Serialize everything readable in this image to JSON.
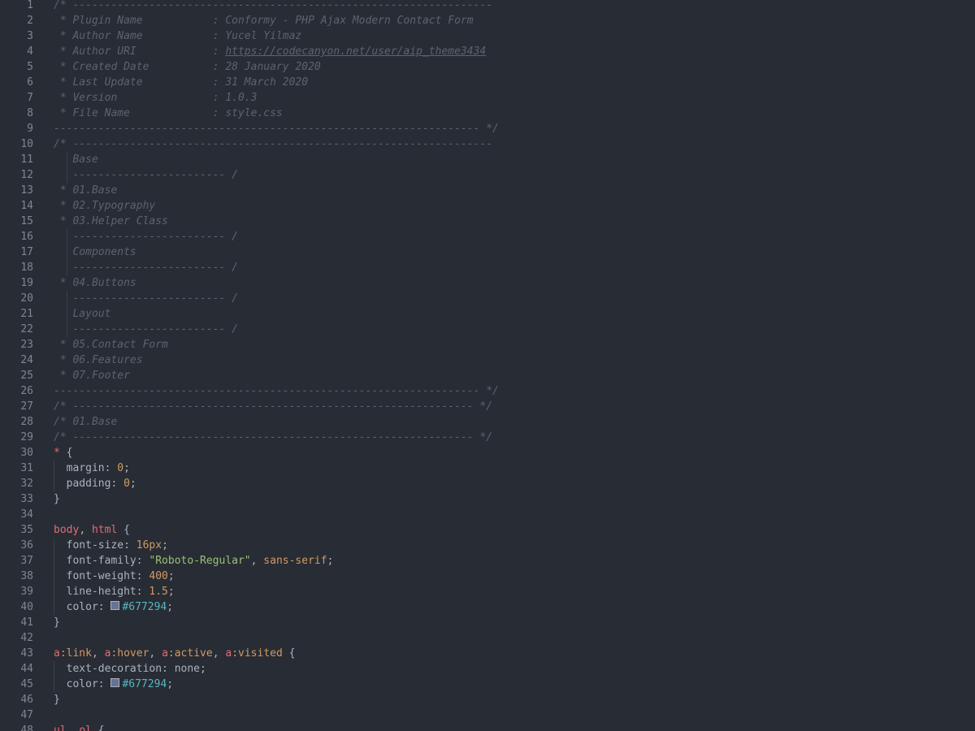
{
  "editor": {
    "language": "css",
    "theme_colors": {
      "background": "#282c34",
      "gutter_text": "#7f8594",
      "comment": "#5c6370",
      "selector": "#e06c75",
      "number": "#d19a66",
      "string": "#98c379",
      "color_value": "#56b6c2",
      "swatch_color": "#677294"
    },
    "lines": [
      {
        "n": "1",
        "tokens": [
          {
            "t": "comment",
            "v": "/* ------------------------------------------------------------------"
          }
        ]
      },
      {
        "n": "2",
        "tokens": [
          {
            "t": "comment",
            "v": " * Plugin Name           : Conformy - PHP Ajax Modern Contact Form"
          }
        ]
      },
      {
        "n": "3",
        "tokens": [
          {
            "t": "comment",
            "v": " * Author Name           : Yucel Yilmaz"
          }
        ]
      },
      {
        "n": "4",
        "tokens": [
          {
            "t": "comment",
            "v": " * Author URI            : "
          },
          {
            "t": "url",
            "v": "https://codecanyon.net/user/aip_theme3434"
          }
        ]
      },
      {
        "n": "5",
        "tokens": [
          {
            "t": "comment",
            "v": " * Created Date          : 28 January 2020"
          }
        ]
      },
      {
        "n": "6",
        "tokens": [
          {
            "t": "comment",
            "v": " * Last Update           : 31 March 2020"
          }
        ]
      },
      {
        "n": "7",
        "tokens": [
          {
            "t": "comment",
            "v": " * Version               : 1.0.3"
          }
        ]
      },
      {
        "n": "8",
        "tokens": [
          {
            "t": "comment",
            "v": " * File Name             : style.css"
          }
        ]
      },
      {
        "n": "9",
        "tokens": [
          {
            "t": "comment",
            "v": "------------------------------------------------------------------- */"
          }
        ]
      },
      {
        "n": "10",
        "tokens": [
          {
            "t": "comment",
            "v": "/* ------------------------------------------------------------------"
          }
        ]
      },
      {
        "n": "11",
        "tokens": [
          {
            "t": "comment",
            "v": "   Base"
          }
        ]
      },
      {
        "n": "12",
        "tokens": [
          {
            "t": "comment",
            "v": "   ------------------------ /"
          }
        ]
      },
      {
        "n": "13",
        "tokens": [
          {
            "t": "comment",
            "v": " * 01.Base"
          }
        ]
      },
      {
        "n": "14",
        "tokens": [
          {
            "t": "comment",
            "v": " * 02.Typography"
          }
        ]
      },
      {
        "n": "15",
        "tokens": [
          {
            "t": "comment",
            "v": " * 03.Helper Class"
          }
        ]
      },
      {
        "n": "16",
        "tokens": [
          {
            "t": "comment",
            "v": "   ------------------------ /"
          }
        ]
      },
      {
        "n": "17",
        "tokens": [
          {
            "t": "comment",
            "v": "   Components"
          }
        ]
      },
      {
        "n": "18",
        "tokens": [
          {
            "t": "comment",
            "v": "   ------------------------ /"
          }
        ]
      },
      {
        "n": "19",
        "tokens": [
          {
            "t": "comment",
            "v": " * 04.Buttons"
          }
        ]
      },
      {
        "n": "20",
        "tokens": [
          {
            "t": "comment",
            "v": "   ------------------------ /"
          }
        ]
      },
      {
        "n": "21",
        "tokens": [
          {
            "t": "comment",
            "v": "   Layout"
          }
        ]
      },
      {
        "n": "22",
        "tokens": [
          {
            "t": "comment",
            "v": "   ------------------------ /"
          }
        ]
      },
      {
        "n": "23",
        "tokens": [
          {
            "t": "comment",
            "v": " * 05.Contact Form"
          }
        ]
      },
      {
        "n": "24",
        "tokens": [
          {
            "t": "comment",
            "v": " * 06.Features"
          }
        ]
      },
      {
        "n": "25",
        "tokens": [
          {
            "t": "comment",
            "v": " * 07.Footer"
          }
        ]
      },
      {
        "n": "26",
        "tokens": [
          {
            "t": "comment",
            "v": "------------------------------------------------------------------- */"
          }
        ]
      },
      {
        "n": "27",
        "tokens": [
          {
            "t": "comment",
            "v": "/* --------------------------------------------------------------- */"
          }
        ]
      },
      {
        "n": "28",
        "tokens": [
          {
            "t": "comment",
            "v": "/* 01.Base"
          }
        ]
      },
      {
        "n": "29",
        "tokens": [
          {
            "t": "comment",
            "v": "/* --------------------------------------------------------------- */"
          }
        ]
      },
      {
        "n": "30",
        "tokens": [
          {
            "t": "selector",
            "v": "*"
          },
          {
            "t": "punct",
            "v": " {"
          }
        ]
      },
      {
        "n": "31",
        "tokens": [
          {
            "t": "prop",
            "v": "  margin: "
          },
          {
            "t": "number",
            "v": "0"
          },
          {
            "t": "punct",
            "v": ";"
          }
        ]
      },
      {
        "n": "32",
        "tokens": [
          {
            "t": "prop",
            "v": "  padding: "
          },
          {
            "t": "number",
            "v": "0"
          },
          {
            "t": "punct",
            "v": ";"
          }
        ]
      },
      {
        "n": "33",
        "tokens": [
          {
            "t": "punct",
            "v": "}"
          }
        ]
      },
      {
        "n": "34",
        "tokens": []
      },
      {
        "n": "35",
        "tokens": [
          {
            "t": "selector",
            "v": "body"
          },
          {
            "t": "punct",
            "v": ", "
          },
          {
            "t": "selector",
            "v": "html"
          },
          {
            "t": "punct",
            "v": " {"
          }
        ]
      },
      {
        "n": "36",
        "tokens": [
          {
            "t": "prop",
            "v": "  font-size: "
          },
          {
            "t": "number",
            "v": "16px"
          },
          {
            "t": "punct",
            "v": ";"
          }
        ]
      },
      {
        "n": "37",
        "tokens": [
          {
            "t": "prop",
            "v": "  font-family: "
          },
          {
            "t": "string",
            "v": "\"Roboto-Regular\""
          },
          {
            "t": "punct",
            "v": ", "
          },
          {
            "t": "keyword",
            "v": "sans-serif"
          },
          {
            "t": "punct",
            "v": ";"
          }
        ]
      },
      {
        "n": "38",
        "tokens": [
          {
            "t": "prop",
            "v": "  font-weight: "
          },
          {
            "t": "number",
            "v": "400"
          },
          {
            "t": "punct",
            "v": ";"
          }
        ]
      },
      {
        "n": "39",
        "tokens": [
          {
            "t": "prop",
            "v": "  line-height: "
          },
          {
            "t": "number",
            "v": "1.5"
          },
          {
            "t": "punct",
            "v": ";"
          }
        ]
      },
      {
        "n": "40",
        "tokens": [
          {
            "t": "prop",
            "v": "  color: "
          },
          {
            "t": "swatch",
            "v": "#677294"
          },
          {
            "t": "color",
            "v": "#677294"
          },
          {
            "t": "punct",
            "v": ";"
          }
        ]
      },
      {
        "n": "41",
        "tokens": [
          {
            "t": "punct",
            "v": "}"
          }
        ]
      },
      {
        "n": "42",
        "tokens": []
      },
      {
        "n": "43",
        "tokens": [
          {
            "t": "selector",
            "v": "a"
          },
          {
            "t": "keyword",
            "v": ":link"
          },
          {
            "t": "punct",
            "v": ", "
          },
          {
            "t": "selector",
            "v": "a"
          },
          {
            "t": "keyword",
            "v": ":hover"
          },
          {
            "t": "punct",
            "v": ", "
          },
          {
            "t": "selector",
            "v": "a"
          },
          {
            "t": "keyword",
            "v": ":active"
          },
          {
            "t": "punct",
            "v": ", "
          },
          {
            "t": "selector",
            "v": "a"
          },
          {
            "t": "keyword",
            "v": ":visited"
          },
          {
            "t": "punct",
            "v": " {"
          }
        ]
      },
      {
        "n": "44",
        "tokens": [
          {
            "t": "prop",
            "v": "  text-decoration: none;"
          }
        ]
      },
      {
        "n": "45",
        "tokens": [
          {
            "t": "prop",
            "v": "  color: "
          },
          {
            "t": "swatch",
            "v": "#677294"
          },
          {
            "t": "color",
            "v": "#677294"
          },
          {
            "t": "punct",
            "v": ";"
          }
        ]
      },
      {
        "n": "46",
        "tokens": [
          {
            "t": "punct",
            "v": "}"
          }
        ]
      },
      {
        "n": "47",
        "tokens": []
      },
      {
        "n": "48",
        "tokens": [
          {
            "t": "selector",
            "v": "ul"
          },
          {
            "t": "punct",
            "v": ", "
          },
          {
            "t": "selector",
            "v": "ol"
          },
          {
            "t": "punct",
            "v": " {"
          }
        ]
      }
    ]
  }
}
